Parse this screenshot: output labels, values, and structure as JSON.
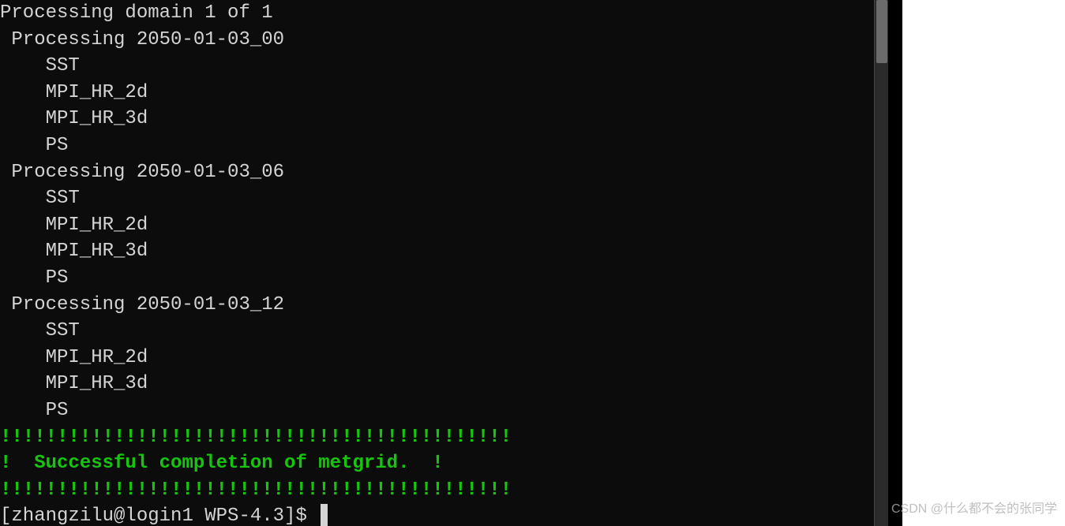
{
  "terminal": {
    "header": "Processing domain 1 of 1",
    "blocks": [
      {
        "title": "Processing 2050-01-03_00",
        "items": [
          "SST",
          "MPI_HR_2d",
          "MPI_HR_3d",
          "PS"
        ]
      },
      {
        "title": "Processing 2050-01-03_06",
        "items": [
          "SST",
          "MPI_HR_2d",
          "MPI_HR_3d",
          "PS"
        ]
      },
      {
        "title": "Processing 2050-01-03_12",
        "items": [
          "SST",
          "MPI_HR_2d",
          "MPI_HR_3d",
          "PS"
        ]
      }
    ],
    "success_border": "!!!!!!!!!!!!!!!!!!!!!!!!!!!!!!!!!!!!!!!!!!!!!",
    "success_message": "!  Successful completion of metgrid.  !",
    "prompt": "[zhangzilu@login1 WPS-4.3]$ "
  },
  "watermark": "CSDN @什么都不会的张同学"
}
